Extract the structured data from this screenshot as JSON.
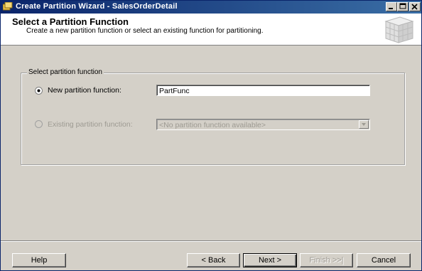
{
  "window": {
    "title": "Create Partition Wizard - SalesOrderDetail"
  },
  "header": {
    "title": "Select a Partition Function",
    "subtitle": "Create a new partition function or select an existing function for partitioning."
  },
  "group": {
    "legend": "Select partition function",
    "new_option": {
      "label": "New partition function:",
      "selected": true,
      "value": "PartFunc"
    },
    "existing_option": {
      "label": "Existing partition function:",
      "selected": false,
      "enabled": false,
      "value": "<No partition function available>"
    }
  },
  "buttons": {
    "help": "Help",
    "back": "< Back",
    "next": "Next >",
    "finish": "Finish >>|",
    "cancel": "Cancel"
  },
  "colors": {
    "titlebar_start": "#0a246a",
    "titlebar_end": "#3a6ea5",
    "face": "#d4d0c8"
  }
}
